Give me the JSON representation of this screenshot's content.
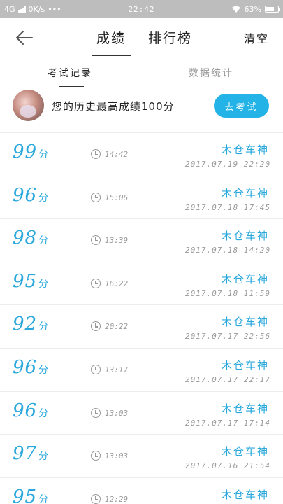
{
  "status_bar": {
    "network": "4G",
    "speed": "0K/s",
    "dots": "•••",
    "time": "22:42",
    "battery": "63%"
  },
  "header": {
    "tabs": [
      {
        "label": "成绩",
        "active": true
      },
      {
        "label": "排行榜",
        "active": false
      }
    ],
    "clear_label": "清空",
    "back_icon": "arrow-left-icon"
  },
  "subtabs": {
    "records": "考试记录",
    "stats": "数据统计"
  },
  "best": {
    "text": "您的历史最高成绩100分",
    "button": "去考试"
  },
  "records": [
    {
      "score": "99",
      "unit": "分",
      "duration": "14:42",
      "name": "木仓车神",
      "date": "2017.07.19  22:20"
    },
    {
      "score": "96",
      "unit": "分",
      "duration": "15:06",
      "name": "木仓车神",
      "date": "2017.07.18  17:45"
    },
    {
      "score": "98",
      "unit": "分",
      "duration": "13:39",
      "name": "木仓车神",
      "date": "2017.07.18  14:20"
    },
    {
      "score": "95",
      "unit": "分",
      "duration": "16:22",
      "name": "木仓车神",
      "date": "2017.07.18  11:59"
    },
    {
      "score": "92",
      "unit": "分",
      "duration": "20:22",
      "name": "木仓车神",
      "date": "2017.07.17  22:56"
    },
    {
      "score": "96",
      "unit": "分",
      "duration": "13:17",
      "name": "木仓车神",
      "date": "2017.07.17  22:17"
    },
    {
      "score": "96",
      "unit": "分",
      "duration": "13:03",
      "name": "木仓车神",
      "date": "2017.07.17  17:14"
    },
    {
      "score": "97",
      "unit": "分",
      "duration": "13:03",
      "name": "木仓车神",
      "date": "2017.07.16  21:54"
    },
    {
      "score": "95",
      "unit": "分",
      "duration": "12:29",
      "name": "木仓车神",
      "date": ""
    }
  ]
}
